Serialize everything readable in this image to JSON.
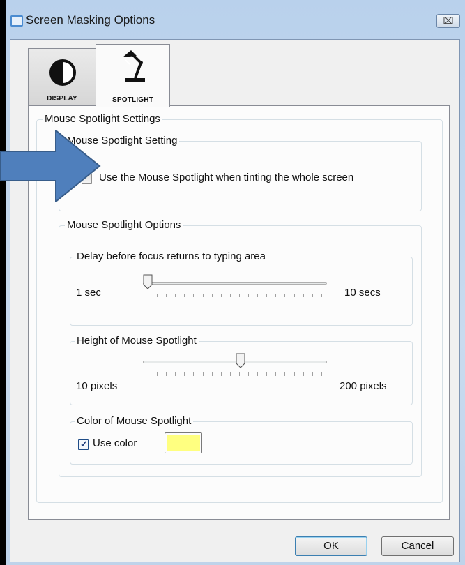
{
  "window": {
    "title": "Screen Masking Options",
    "close_glyph": "⌧"
  },
  "tabs": [
    {
      "label": "DISPLAY",
      "icon": "contrast-icon"
    },
    {
      "label": "SPOTLIGHT",
      "icon": "desk-lamp-icon"
    }
  ],
  "settings": {
    "title": "Mouse Spotlight Settings",
    "setting_group": {
      "title": "Mouse Spotlight Setting",
      "checkbox_label": "Use the Mouse Spotlight when tinting the whole screen",
      "checked": false
    },
    "options_group": {
      "title": "Mouse Spotlight Options",
      "delay": {
        "title": "Delay before focus returns to typing area",
        "min_label": "1 sec",
        "max_label": "10 secs",
        "value_fraction": 0.0
      },
      "height": {
        "title": "Height of Mouse Spotlight",
        "min_label": "10 pixels",
        "max_label": "200 pixels",
        "value_fraction": 0.53
      },
      "color": {
        "title": "Color of Mouse Spotlight",
        "checkbox_label": "Use color",
        "checked": true,
        "swatch_color": "#ffff80"
      }
    }
  },
  "buttons": {
    "ok": "OK",
    "cancel": "Cancel"
  },
  "colors": {
    "arrow_fill": "#4f7fbc",
    "arrow_stroke": "#385d8a"
  }
}
